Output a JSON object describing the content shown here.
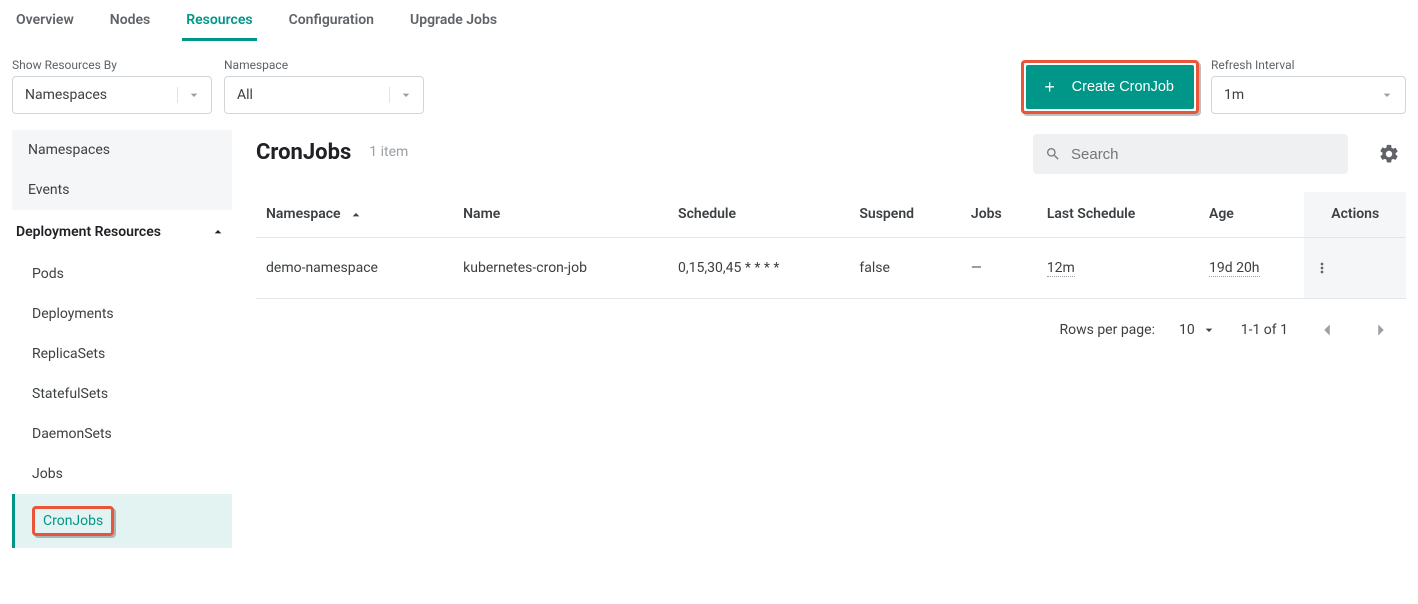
{
  "tabs": {
    "items": [
      "Overview",
      "Nodes",
      "Resources",
      "Configuration",
      "Upgrade Jobs"
    ],
    "active": "Resources"
  },
  "filters": {
    "show_by_label": "Show Resources By",
    "show_by_value": "Namespaces",
    "namespace_label": "Namespace",
    "namespace_value": "All"
  },
  "actions": {
    "create_label": "Create CronJob"
  },
  "refresh": {
    "label": "Refresh Interval",
    "value": "1m"
  },
  "sidebar": {
    "top_items": [
      "Namespaces",
      "Events"
    ],
    "group_label": "Deployment Resources",
    "sub_items": [
      "Pods",
      "Deployments",
      "ReplicaSets",
      "StatefulSets",
      "DaemonSets",
      "Jobs",
      "CronJobs"
    ],
    "active_sub": "CronJobs"
  },
  "page": {
    "title": "CronJobs",
    "item_count": "1 item",
    "search_placeholder": "Search"
  },
  "table": {
    "headers": {
      "namespace": "Namespace",
      "name": "Name",
      "schedule": "Schedule",
      "suspend": "Suspend",
      "jobs": "Jobs",
      "last_schedule": "Last Schedule",
      "age": "Age",
      "actions": "Actions"
    },
    "rows": [
      {
        "namespace": "demo-namespace",
        "name": "kubernetes-cron-job",
        "schedule": "0,15,30,45 * * * *",
        "suspend": "false",
        "jobs": "—",
        "last_schedule": "12m",
        "age": "19d 20h"
      }
    ]
  },
  "pager": {
    "rows_label": "Rows per page:",
    "rows_value": "10",
    "range": "1-1 of 1"
  }
}
